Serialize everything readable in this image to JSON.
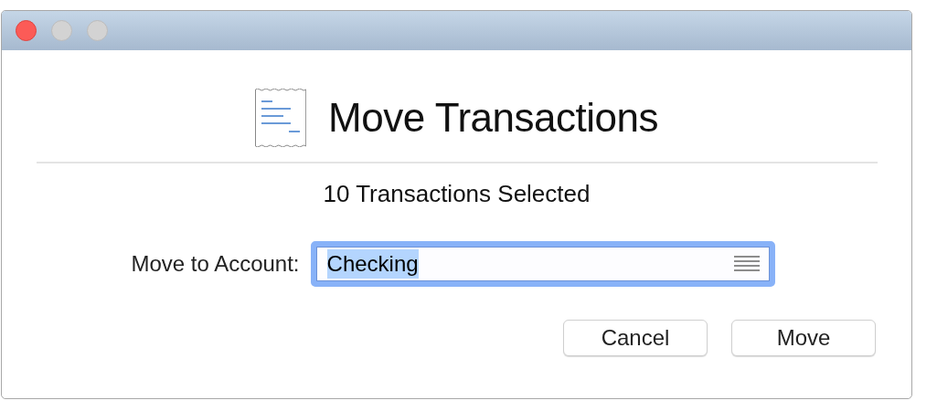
{
  "window": {
    "buttons": [
      {
        "active": true
      },
      {
        "active": false
      },
      {
        "active": false
      }
    ]
  },
  "dialog": {
    "title": "Move Transactions",
    "subtitle": "10 Transactions Selected",
    "field": {
      "label": "Move to Account:",
      "value": "Checking",
      "focused": true,
      "text_selected": true
    },
    "buttons": [
      "Cancel",
      "Move"
    ]
  }
}
